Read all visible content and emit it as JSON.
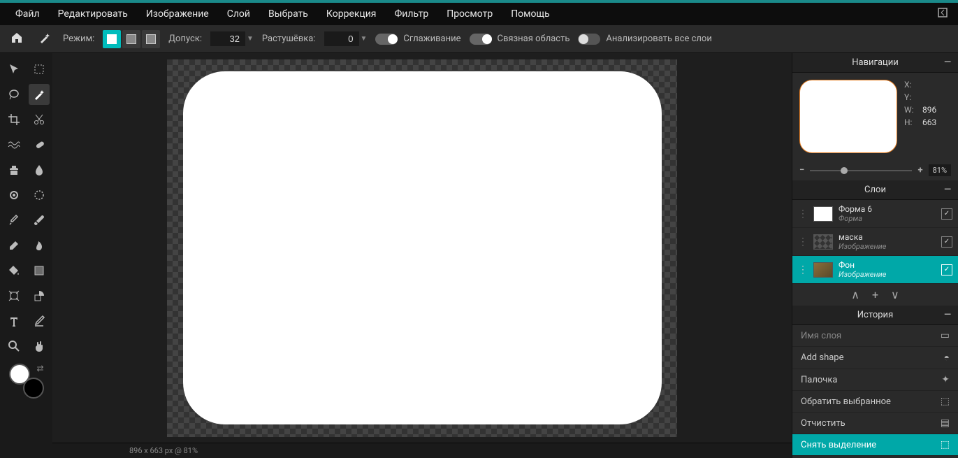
{
  "menubar": {
    "items": [
      "Файл",
      "Редактировать",
      "Изображение",
      "Слой",
      "Выбрать",
      "Коррекция",
      "Фильтр",
      "Просмотр",
      "Помощь"
    ]
  },
  "optbar": {
    "mode_label": "Режим:",
    "tolerance_label": "Допуск:",
    "tolerance_value": "32",
    "feather_label": "Растушёвка:",
    "feather_value": "0",
    "antialias_label": "Сглаживание",
    "contiguous_label": "Связная область",
    "all_layers_label": "Анализировать все слои"
  },
  "canvas": {
    "status": "896 x 663 px @ 81%"
  },
  "nav": {
    "title": "Навигации",
    "x_label": "X:",
    "y_label": "Y:",
    "w_label": "W:",
    "h_label": "H:",
    "w_value": "896",
    "h_value": "663",
    "zoom_value": "81%"
  },
  "layers": {
    "title": "Слои",
    "items": [
      {
        "name": "Форма 6",
        "type": "Форма"
      },
      {
        "name": "маска",
        "type": "Изображение"
      },
      {
        "name": "Фон",
        "type": "Изображение"
      }
    ]
  },
  "history": {
    "title": "История",
    "items": [
      {
        "label": "Имя слоя",
        "dim": true
      },
      {
        "label": "Add shape"
      },
      {
        "label": "Палочка"
      },
      {
        "label": "Обратить выбранное"
      },
      {
        "label": "Отчистить"
      },
      {
        "label": "Снять выделение",
        "active": true
      }
    ]
  }
}
